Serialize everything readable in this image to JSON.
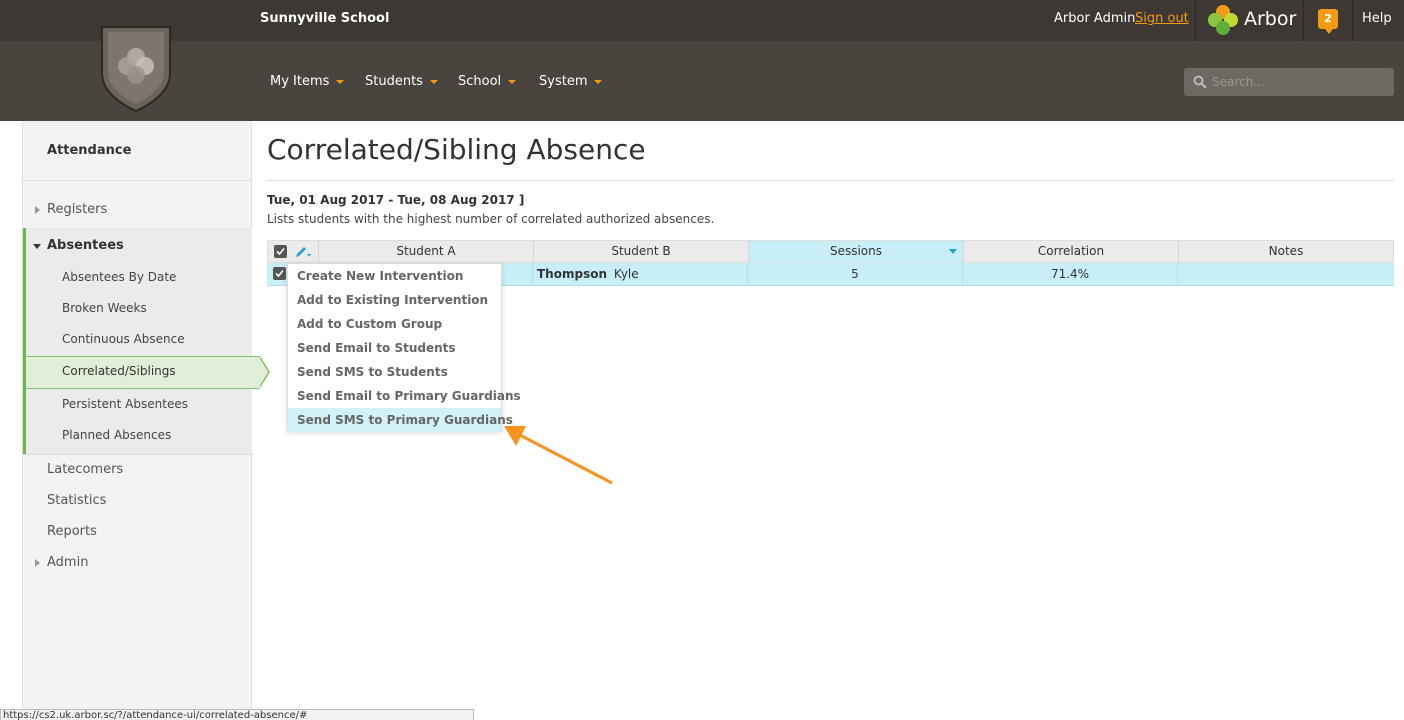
{
  "header": {
    "school_name": "Sunnyville School",
    "user_name": "Arbor Admin",
    "sign_out": "Sign out",
    "brand": "Arbor",
    "notifications_count": "2",
    "help": "Help",
    "search_placeholder": "Search...",
    "nav": [
      "My Items",
      "Students",
      "School",
      "System"
    ]
  },
  "sidebar": {
    "title": "Attendance",
    "items": {
      "registers": "Registers",
      "absentees": "Absentees",
      "absentees_by_date": "Absentees By Date",
      "broken_weeks": "Broken Weeks",
      "continuous_absence": "Continuous Absence",
      "correlated_siblings": "Correlated/Siblings",
      "persistent_absentees": "Persistent Absentees",
      "planned_absences": "Planned Absences",
      "latecomers": "Latecomers",
      "statistics": "Statistics",
      "reports": "Reports",
      "admin": "Admin"
    }
  },
  "main": {
    "title": "Correlated/Sibling Absence",
    "date_range": "Tue, 01 Aug 2017 - Tue, 08 Aug 2017 ]",
    "description": "Lists students with the highest number of correlated authorized absences.",
    "table": {
      "columns": [
        "Student A",
        "Student B",
        "Sessions",
        "Correlation",
        "Notes"
      ],
      "sorted_column": "Sessions",
      "rows": [
        {
          "student_b_last": "Thompson",
          "student_b_first": "Kyle",
          "sessions": "5",
          "correlation": "71.4%",
          "notes": ""
        }
      ]
    },
    "menu": [
      "Create New Intervention",
      "Add to Existing Intervention",
      "Add to Custom Group",
      "Send Email to Students",
      "Send SMS to Students",
      "Send Email to Primary Guardians",
      "Send SMS to Primary Guardians"
    ],
    "menu_highlighted": "Send SMS to Primary Guardians"
  },
  "status_url": "https://cs2.uk.arbor.sc/?/attendance-ui/correlated-absence/#",
  "colors": {
    "header_bg": "#3d3833",
    "nav_bg": "#4a443f",
    "accent_orange": "#f39c12",
    "sidebar_active": "#e2efd8",
    "sidebar_green": "#71b54f",
    "row_highlight": "#c8eef8"
  }
}
